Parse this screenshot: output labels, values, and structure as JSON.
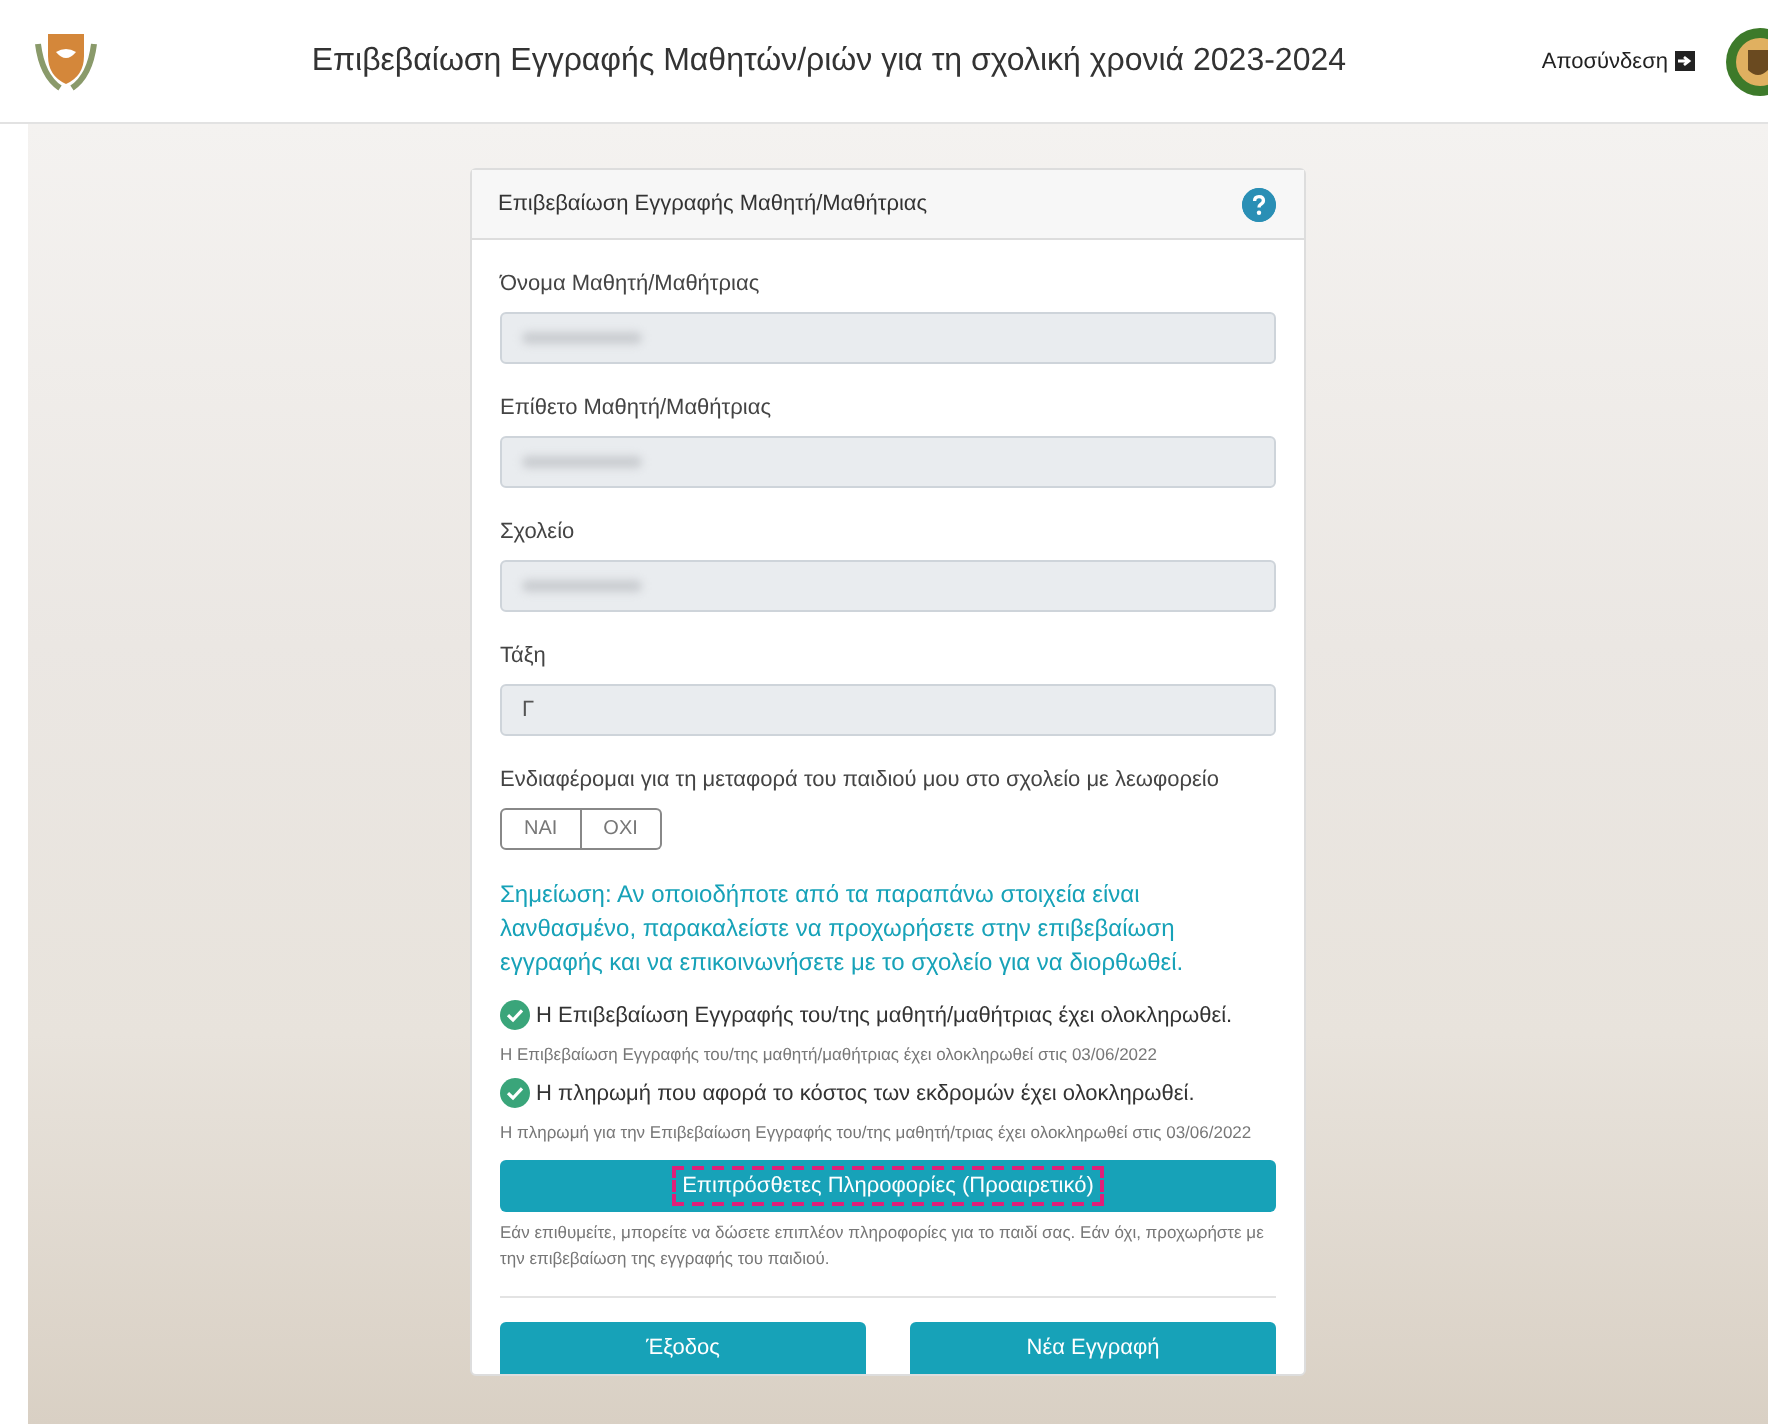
{
  "header": {
    "title": "Επιβεβαίωση Εγγραφής Μαθητών/ριών για τη σχολική χρονιά 2023-2024",
    "logout": "Αποσύνδεση"
  },
  "card": {
    "title": "Επιβεβαίωση Εγγραφής Μαθητή/Μαθήτριας",
    "fields": [
      {
        "label": "Όνομα Μαθητή/Μαθήτριας",
        "kind": "blurred"
      },
      {
        "label": "Επίθετο Μαθητή/Μαθήτριας",
        "kind": "blurred"
      },
      {
        "label": "Σχολείο",
        "kind": "blurred"
      },
      {
        "label": "Τάξη",
        "kind": "text",
        "value": "Γ"
      }
    ],
    "transport": {
      "label": "Ενδιαφέρομαι για τη μεταφορά του παιδιού μου στο σχολείο με λεωφορείο",
      "options": [
        {
          "label": "ΝΑΙ",
          "selected": false
        },
        {
          "label": "ΟΧΙ",
          "selected": false
        }
      ]
    },
    "note": "Σημείωση: Αν οποιοδήποτε από τα παραπάνω στοιχεία είναι λανθασμένο, παρακαλείστε να προχωρήσετε στην επιβεβαίωση εγγραφής και να επικοινωνήσετε με το σχολείο για να διορθωθεί.",
    "statuses": [
      {
        "text": "Η Επιβεβαίωση Εγγραφής του/της μαθητή/μαθήτριας έχει ολοκληρωθεί.",
        "done": true,
        "detail": "Η Επιβεβαίωση Εγγραφής του/της μαθητή/μαθήτριας έχει ολοκληρωθεί στις 03/06/2022"
      },
      {
        "text": "Η πληρωμή που αφορά το κόστος των εκδρομών έχει ολοκληρωθεί.",
        "done": true,
        "detail": "Η πληρωμή για την Επιβεβαίωση Εγγραφής του/της μαθητή/τριας έχει ολοκληρωθεί στις 03/06/2022"
      }
    ],
    "extra_button": {
      "label": "Επιπρόσθετες Πληροφορίες (Προαιρετικό)",
      "focused": true
    },
    "extra_help": "Εάν επιθυμείτε, μπορείτε να δώσετε επιπλέον πληροφορίες για το παιδί σας. Εάν όχι, προχωρήστε με την επιβεβαίωση της εγγραφής του παιδιού.",
    "buttons": [
      "Έξοδος",
      "Νέα Εγγραφή"
    ]
  }
}
